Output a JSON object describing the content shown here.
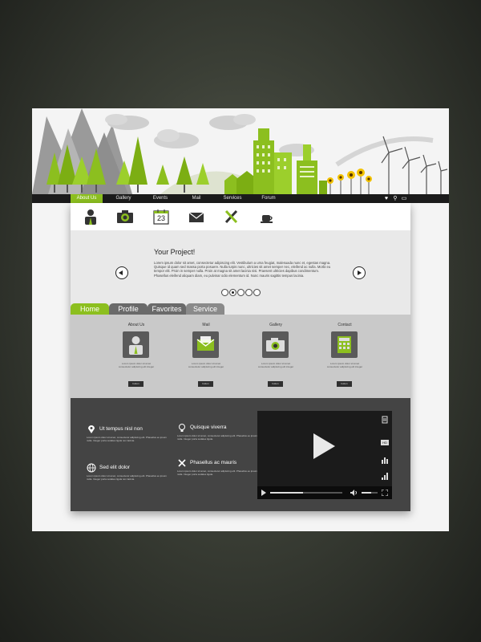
{
  "nav": {
    "items": [
      "About Us",
      "Gallery",
      "Events",
      "Mail",
      "Services",
      "Forum"
    ],
    "active": "About Us",
    "right_icons": [
      "heart-icon",
      "search-icon",
      "chat-icon"
    ]
  },
  "top_icons": [
    "person-icon",
    "camera-icon",
    "calendar-icon",
    "mail-icon",
    "tools-icon",
    "coffee-icon"
  ],
  "calendar_day": "23",
  "slider": {
    "title": "Your Project!",
    "text": "Lorem ipsum dolor sit amet, consectetur adipiscing elit. Vestibulum a urna feugiat, malesuada nunc et, egestas magna. Quisque id quam sed massa porta posuere. Nulla turpis nunc, ultricies sit amet semper nec, eleifend ac nulla. Morbi eu tempor elit. Proin in semper nulla. Proin at magna sit amet lacinia nisi. Praesent ultricies dapibus condimentum. Phasellus eleifend aliquam diam, eu pulvinar odio elementum id. Nunc mauris sagittis tempus lacinia.",
    "dot_count": 5,
    "active_dot": 2
  },
  "tabs": [
    "Home",
    "Profile",
    "Favorites",
    "Service"
  ],
  "features": [
    {
      "title": "About Us",
      "icon": "person-icon",
      "text": "Lorem ipsum dolor sit amet consectetur adipiscing elit integer",
      "button": "button"
    },
    {
      "title": "Mail",
      "icon": "mail-icon",
      "text": "Lorem ipsum dolor sit amet consectetur adipiscing elit integer",
      "button": "button"
    },
    {
      "title": "Gallery",
      "icon": "camera-icon",
      "text": "Lorem ipsum dolor sit amet consectetur adipiscing elit integer",
      "button": "button"
    },
    {
      "title": "Contact",
      "icon": "calculator-icon",
      "text": "Lorem ipsum dolor sit amet consectetur adipiscing elit integer",
      "button": "button"
    }
  ],
  "info": [
    {
      "title": "Ut tempus nisl non",
      "icon": "map-pin-icon",
      "text": "Lorem ipsum dolor sit amet, consectetur adipiscing elit. Phasellus eu ipsum nulla. Integer porta sodales ligula non lacinia."
    },
    {
      "title": "Quisque viverra",
      "icon": "lightbulb-icon",
      "text": "Lorem ipsum dolor sit amet, consectetur adipiscing elit. Phasellus eu ipsum nulla. Integer porta sodales ligula."
    },
    {
      "title": "Sed elit dolor",
      "icon": "globe-icon",
      "text": "Lorem ipsum dolor sit amet, consectetur adipiscing elit. Phasellus eu ipsum nulla. Integer porta sodales ligula non lacinia."
    },
    {
      "title": "Phasellus ac mauris",
      "icon": "tools-icon",
      "text": "Lorem ipsum dolor sit amet, consectetur adipiscing elit. Phasellus eu ipsum nulla. Integer porta sodales ligula."
    }
  ],
  "video": {
    "quality_label": "HD",
    "progress": 0.45,
    "volume": 0.6
  },
  "colors": {
    "accent": "#8cbf1f",
    "dark_panel": "#444444",
    "nav_bg": "#1b1b1b",
    "feature_bg": "#c9c9c9"
  }
}
